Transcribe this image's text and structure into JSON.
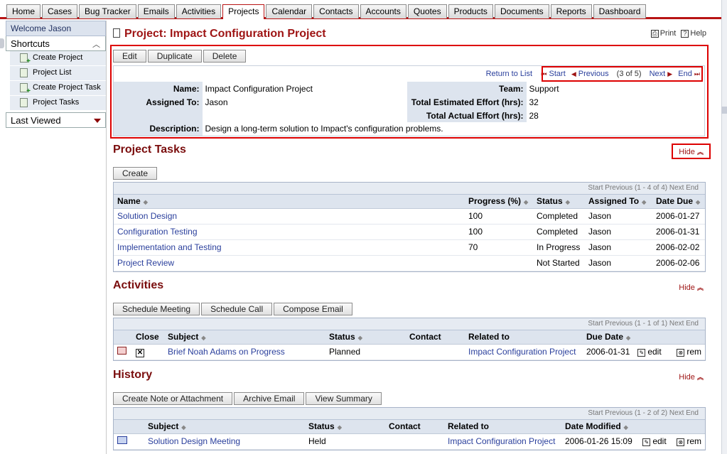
{
  "tabs": [
    "Home",
    "Cases",
    "Bug Tracker",
    "Emails",
    "Activities",
    "Projects",
    "Calendar",
    "Contacts",
    "Accounts",
    "Quotes",
    "Products",
    "Documents",
    "Reports",
    "Dashboard"
  ],
  "active_tab": "Projects",
  "sidebar": {
    "welcome": "Welcome Jason",
    "shortcuts_title": "Shortcuts",
    "shortcuts": [
      "Create Project",
      "Project List",
      "Create Project Task",
      "Project Tasks"
    ],
    "last_viewed": "Last Viewed"
  },
  "page": {
    "title": "Project: Impact Configuration Project",
    "print": "Print",
    "help": "Help"
  },
  "detail": {
    "buttons": [
      "Edit",
      "Duplicate",
      "Delete"
    ],
    "return_to_list": "Return to List",
    "nav": {
      "start": "Start",
      "previous": "Previous",
      "position": "(3 of 5)",
      "next": "Next",
      "end": "End"
    },
    "fields": {
      "name_label": "Name:",
      "name": "Impact Configuration Project",
      "team_label": "Team:",
      "team": "Support",
      "assigned_label": "Assigned To:",
      "assigned": "Jason",
      "est_label": "Total Estimated Effort (hrs):",
      "est": "32",
      "actual_label": "Total Actual Effort (hrs):",
      "actual": "28",
      "desc_label": "Description:",
      "desc": "Design a long-term solution to Impact's configuration problems."
    }
  },
  "tasks": {
    "title": "Project Tasks",
    "hide": "Hide",
    "create": "Create",
    "pager": "Start  Previous  (1 - 4 of 4)  Next  End",
    "headers": [
      "Name",
      "Progress (%)",
      "Status",
      "Assigned To",
      "Date Due"
    ],
    "rows": [
      {
        "name": "Solution Design",
        "progress": "100",
        "status": "Completed",
        "assigned": "Jason",
        "due": "2006-01-27"
      },
      {
        "name": "Configuration Testing",
        "progress": "100",
        "status": "Completed",
        "assigned": "Jason",
        "due": "2006-01-31"
      },
      {
        "name": "Implementation and Testing",
        "progress": "70",
        "status": "In Progress",
        "assigned": "Jason",
        "due": "2006-02-02"
      },
      {
        "name": "Project Review",
        "progress": "",
        "status": "Not Started",
        "assigned": "Jason",
        "due": "2006-02-06"
      }
    ]
  },
  "activities": {
    "title": "Activities",
    "hide": "Hide",
    "buttons": [
      "Schedule Meeting",
      "Schedule Call",
      "Compose Email"
    ],
    "pager": "Start  Previous  (1 - 1 of 1)  Next  End",
    "headers": [
      "Close",
      "Subject",
      "Status",
      "Contact",
      "Related to",
      "Due Date"
    ],
    "rows": [
      {
        "subject": "Brief Noah Adams on Progress",
        "status": "Planned",
        "contact": "",
        "related": "Impact Configuration Project",
        "due": "2006-01-31",
        "edit": "edit",
        "rem": "rem"
      }
    ]
  },
  "history": {
    "title": "History",
    "hide": "Hide",
    "buttons": [
      "Create Note or Attachment",
      "Archive Email",
      "View Summary"
    ],
    "pager": "Start  Previous  (1 - 2 of 2)  Next  End",
    "headers": [
      "Subject",
      "Status",
      "Contact",
      "Related to",
      "Date Modified"
    ],
    "rows": [
      {
        "subject": "Solution Design Meeting",
        "status": "Held",
        "contact": "",
        "related": "Impact Configuration Project",
        "modified": "2006-01-26 15:09",
        "edit": "edit",
        "rem": "rem"
      }
    ]
  },
  "colors": {
    "accent": "#9e1414",
    "link": "#2a3f9c",
    "header_bg": "#dde4ee",
    "highlight": "#dd0000"
  }
}
